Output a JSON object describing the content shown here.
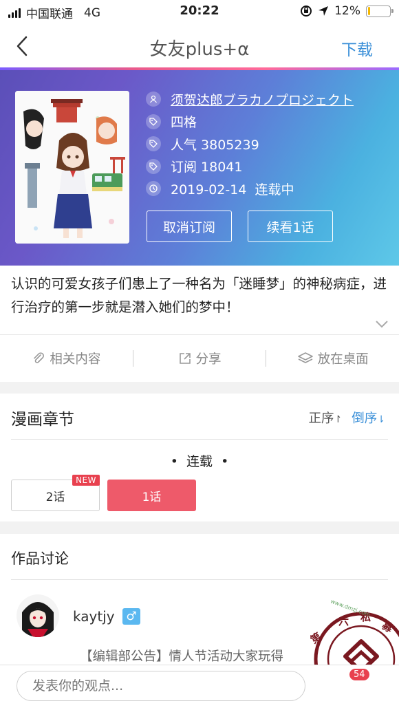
{
  "status_bar": {
    "carrier": "中国联通",
    "network": "4G",
    "time": "20:22",
    "battery": "12%"
  },
  "nav": {
    "title": "女友plus+α",
    "download_label": "下载"
  },
  "comic": {
    "author": "须贺达郎ブラカノプロジェクト",
    "genre": "四格",
    "popularity": "人气 3805239",
    "subscriptions": "订阅 18041",
    "update": "2019-02-14  连载中",
    "unsubscribe_label": "取消订阅",
    "continue_label": "续看1话",
    "description": "认识的可爱女孩子们患上了一种名为「迷睡梦」的神秘病症，进行治疗的第一步就是潜入她们的梦中！"
  },
  "actions": {
    "related": "相关内容",
    "share": "分享",
    "desktop": "放在桌面"
  },
  "chapters": {
    "heading": "漫画章节",
    "sort_asc": "正序",
    "sort_desc": "倒序",
    "status": "•  连载  •",
    "items": [
      {
        "label": "2话",
        "badge": "NEW"
      },
      {
        "label": "1话"
      }
    ]
  },
  "discussion": {
    "heading": "作品讨论",
    "username": "kaytjy",
    "gender_symbol": "♂",
    "post_preview": "【编辑部公告】情人节活动大家玩得"
  },
  "bottom": {
    "comment_placeholder": "发表你的观点...",
    "comment_count": "54"
  },
  "watermark": {
    "text": "www.SiMu001.cn",
    "small_text": "www.dmzj.com",
    "chars": "第 六 私 募"
  },
  "colors": {
    "accent_blue": "#3a8fd8",
    "primary_red": "#ee5a6a",
    "badge_red": "#e8414f"
  }
}
